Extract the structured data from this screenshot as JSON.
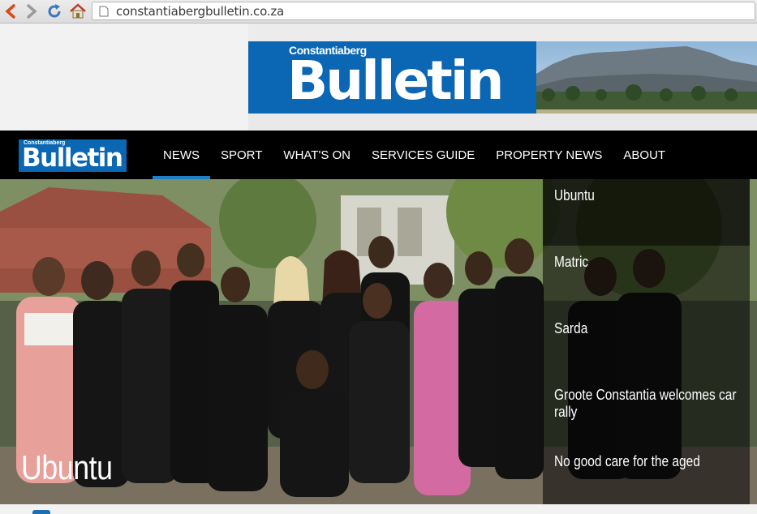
{
  "browser": {
    "url": "constantiabergbulletin.co.za",
    "icons": [
      "back-arrow-icon",
      "forward-arrow-icon",
      "reload-icon",
      "home-icon",
      "page-icon"
    ]
  },
  "banner": {
    "logo_small": "Constantiaberg",
    "logo_big": "Bulletin"
  },
  "nav": {
    "logo_small": "Constantiaberg",
    "logo_big": "Bulletin",
    "items": [
      "NEWS",
      "SPORT",
      "WHAT'S ON",
      "SERVICES GUIDE",
      "PROPERTY NEWS",
      "ABOUT"
    ],
    "active": "NEWS"
  },
  "hero": {
    "title": "Ubuntu",
    "stories": [
      "Ubuntu",
      "Matric",
      "Sarda",
      "Groote Constantia welcomes car rally",
      "No good care for the aged"
    ]
  },
  "colors": {
    "brand_blue": "#0b66b3",
    "nav_bg": "#000000",
    "active_underline": "#1d7fc7"
  }
}
